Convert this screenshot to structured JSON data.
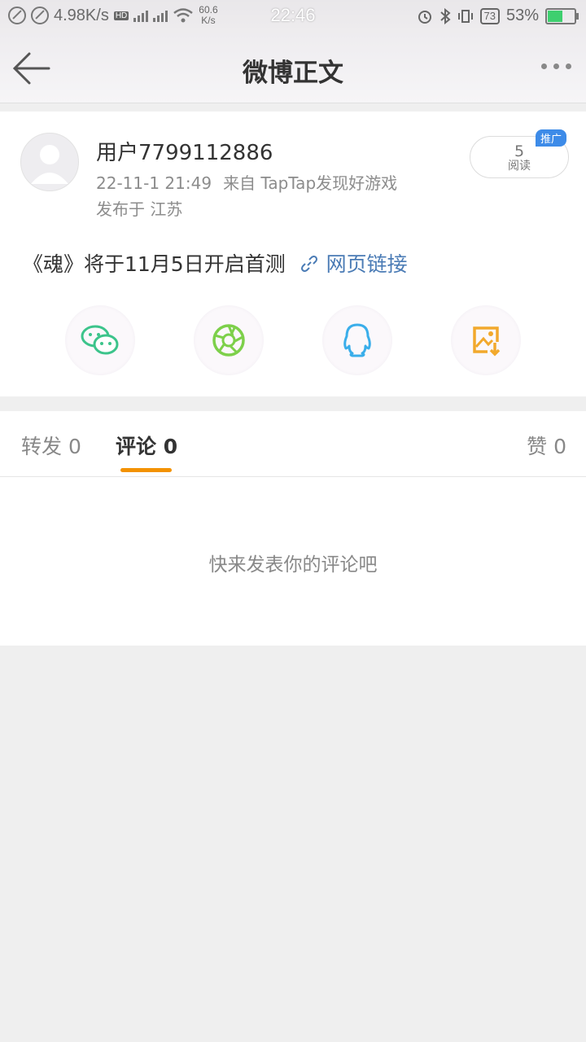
{
  "status_bar": {
    "net_speed": "4.98K/s",
    "wifi_speed": "60.6",
    "wifi_unit": "K/s",
    "time": "22:46",
    "badge": "73",
    "battery": "53%"
  },
  "nav": {
    "title": "微博正文"
  },
  "post": {
    "username": "用户7799112886",
    "date": "22-11-1 21:49",
    "source": "来自 TapTap发现好游戏",
    "location": "发布于 江苏",
    "read_count": "5",
    "read_label": "阅读",
    "promo_badge": "推广",
    "content_text": "《魂》将于11月5日开启首测",
    "link_text": "网页链接"
  },
  "share_icons": [
    "wechat-icon",
    "moments-icon",
    "qq-icon",
    "save-image-icon"
  ],
  "tabs": {
    "repost": "转发 0",
    "comment": "评论 0",
    "like": "赞 0"
  },
  "comments": {
    "empty_text": "快来发表你的评论吧"
  },
  "colors": {
    "accent": "#f39200",
    "link": "#4a7bb5",
    "promo": "#3d8be8",
    "wechat": "#3cc48b",
    "moments": "#7dd04a",
    "qq": "#3aaeea",
    "save": "#f2a92c"
  }
}
